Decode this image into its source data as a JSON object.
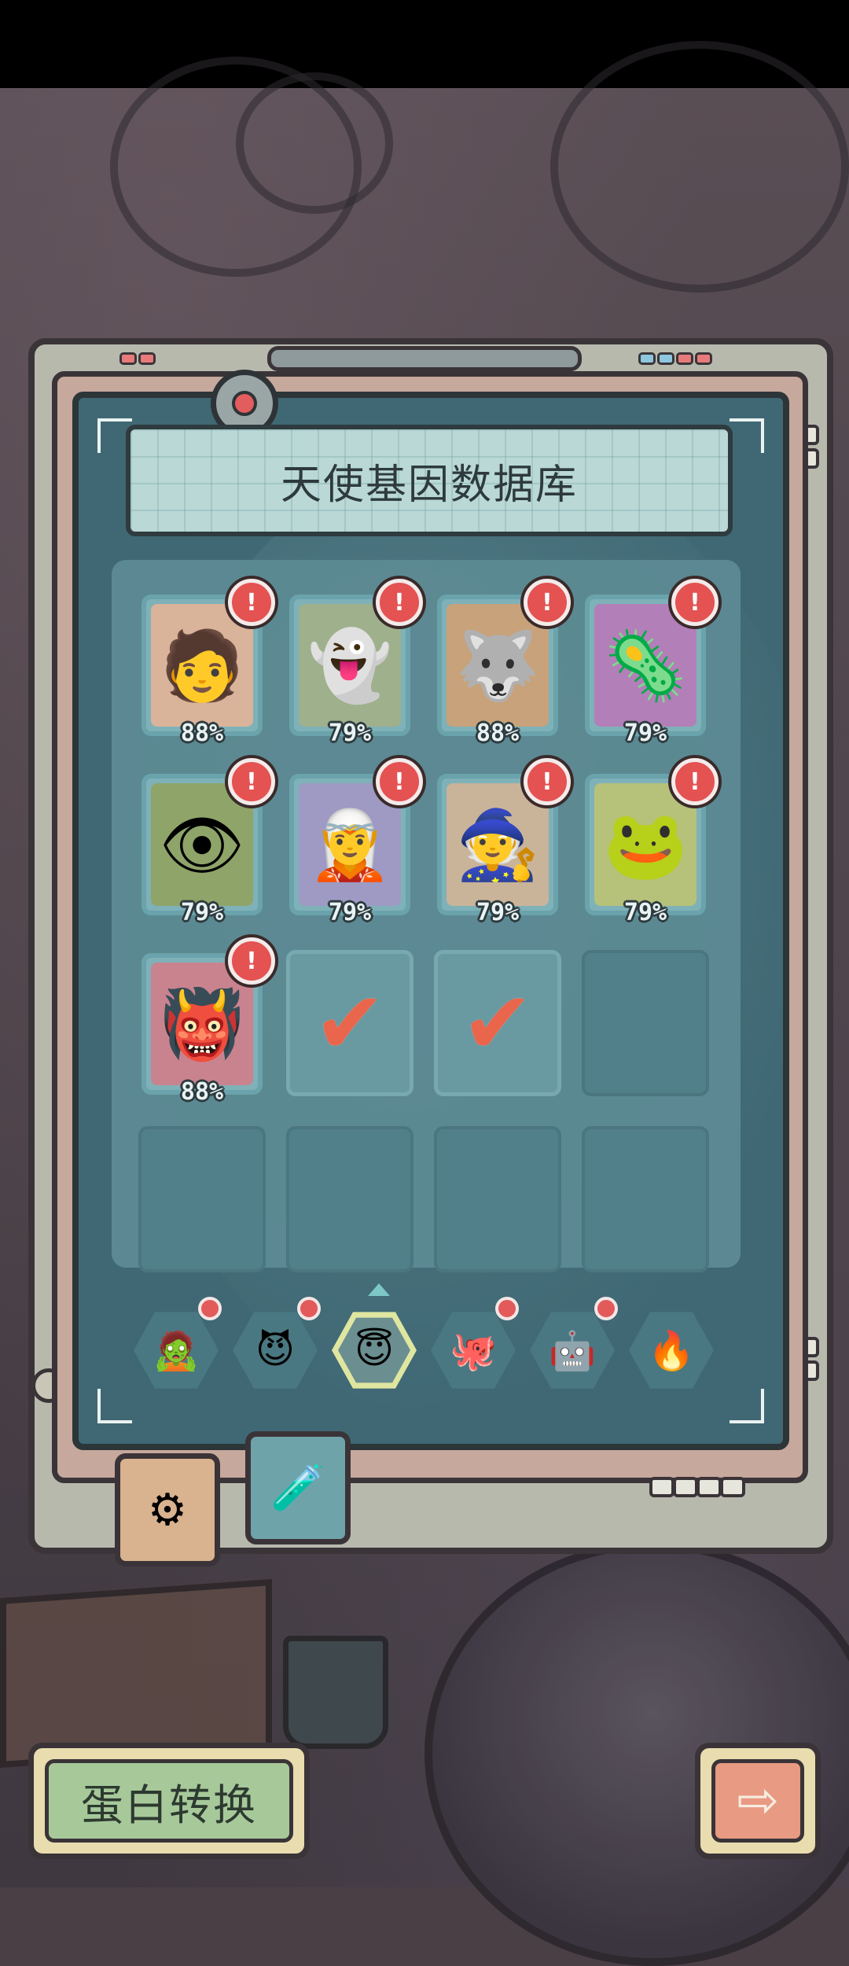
{
  "title": "天使基因数据库",
  "cards": [
    {
      "name": "card-muscle-man",
      "pct": "88%",
      "emoji": "🧑",
      "bg": "#d9b39a",
      "alert": "!"
    },
    {
      "name": "card-ghost-blob",
      "pct": "79%",
      "emoji": "👻",
      "bg": "#9fb08d",
      "alert": "!"
    },
    {
      "name": "card-beast-warrior",
      "pct": "88%",
      "emoji": "🐺",
      "bg": "#c8a27a",
      "alert": "!"
    },
    {
      "name": "card-purple-virus",
      "pct": "79%",
      "emoji": "🦠",
      "bg": "#b27fb8",
      "alert": "!"
    },
    {
      "name": "card-eye-stalk-monster",
      "pct": "79%",
      "emoji": "👁",
      "bg": "#8fa469",
      "alert": "!"
    },
    {
      "name": "card-dark-elf",
      "pct": "79%",
      "emoji": "🧝",
      "bg": "#9e9ac4",
      "alert": "!"
    },
    {
      "name": "card-bearded-king",
      "pct": "79%",
      "emoji": "🧙",
      "bg": "#c9b49a",
      "alert": "!"
    },
    {
      "name": "card-bug-warrior",
      "pct": "79%",
      "emoji": "🐸",
      "bg": "#b6c27a",
      "alert": "!"
    },
    {
      "name": "card-eye-demon",
      "pct": "88%",
      "emoji": "👹",
      "bg": "#c9838f",
      "alert": "!"
    }
  ],
  "completed": [
    {
      "name": "completed-cat-silhouette",
      "mark": "✔"
    },
    {
      "name": "completed-eye-silhouette",
      "mark": "✔"
    }
  ],
  "category_tabs": [
    {
      "name": "tab-zombie",
      "emoji": "🧟",
      "dot": true
    },
    {
      "name": "tab-demon",
      "emoji": "😈",
      "dot": true
    },
    {
      "name": "tab-angel",
      "emoji": "😇",
      "dot": false,
      "selected": true
    },
    {
      "name": "tab-bug",
      "emoji": "🐙",
      "dot": true
    },
    {
      "name": "tab-robot",
      "emoji": "🤖",
      "dot": true
    },
    {
      "name": "tab-fire",
      "emoji": "🔥",
      "dot": false
    }
  ],
  "module_tabs": [
    {
      "name": "module-tab-gene-machine",
      "emoji": "⚙"
    },
    {
      "name": "module-tab-capsule",
      "emoji": "🧪"
    }
  ],
  "buttons": {
    "convert_label": "蛋白转换",
    "next_arrow": "⇨"
  }
}
